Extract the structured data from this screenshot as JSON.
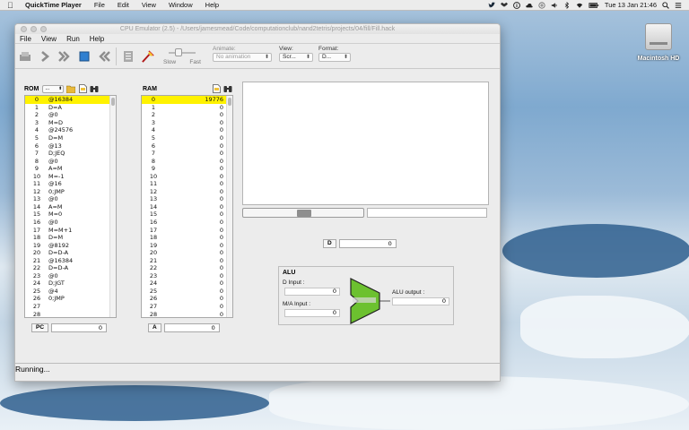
{
  "menubar": {
    "app_name": "QuickTime Player",
    "items": [
      "File",
      "Edit",
      "View",
      "Window",
      "Help"
    ],
    "clock": "Tue 13 Jan  21:46"
  },
  "desktop": {
    "drive_label": "Macintosh HD"
  },
  "window": {
    "title": "CPU Emulator (2.5) - /Users/jamesmead/Code/computationclub/nand2tetris/projects/04/fill/Fill.hack",
    "menu": [
      "File",
      "View",
      "Run",
      "Help"
    ]
  },
  "toolbar": {
    "slow_label": "Slow",
    "fast_label": "Fast",
    "animate_label": "Animate:",
    "animate_value": "No animation",
    "view_label": "View:",
    "view_value": "Scr...",
    "format_label": "Format:",
    "format_value": "D..."
  },
  "rom": {
    "label": "ROM",
    "format_value": "...",
    "rows": [
      {
        "i": "0",
        "v": "@16384"
      },
      {
        "i": "1",
        "v": "D=A"
      },
      {
        "i": "2",
        "v": "@0"
      },
      {
        "i": "3",
        "v": "M=D"
      },
      {
        "i": "4",
        "v": "@24576"
      },
      {
        "i": "5",
        "v": "D=M"
      },
      {
        "i": "6",
        "v": "@13"
      },
      {
        "i": "7",
        "v": "D;JEQ"
      },
      {
        "i": "8",
        "v": "@0"
      },
      {
        "i": "9",
        "v": "A=M"
      },
      {
        "i": "10",
        "v": "M=-1"
      },
      {
        "i": "11",
        "v": "@16"
      },
      {
        "i": "12",
        "v": "0;JMP"
      },
      {
        "i": "13",
        "v": "@0"
      },
      {
        "i": "14",
        "v": "A=M"
      },
      {
        "i": "15",
        "v": "M=0"
      },
      {
        "i": "16",
        "v": "@0"
      },
      {
        "i": "17",
        "v": "M=M+1"
      },
      {
        "i": "18",
        "v": "D=M"
      },
      {
        "i": "19",
        "v": "@8192"
      },
      {
        "i": "20",
        "v": "D=D-A"
      },
      {
        "i": "21",
        "v": "@16384"
      },
      {
        "i": "22",
        "v": "D=D-A"
      },
      {
        "i": "23",
        "v": "@0"
      },
      {
        "i": "24",
        "v": "D;JGT"
      },
      {
        "i": "25",
        "v": "@4"
      },
      {
        "i": "26",
        "v": "0;JMP"
      },
      {
        "i": "27",
        "v": ""
      },
      {
        "i": "28",
        "v": ""
      }
    ],
    "pc_label": "PC",
    "pc_value": "0"
  },
  "ram": {
    "label": "RAM",
    "rows": [
      {
        "i": "0",
        "v": "19776"
      },
      {
        "i": "1",
        "v": "0"
      },
      {
        "i": "2",
        "v": "0"
      },
      {
        "i": "3",
        "v": "0"
      },
      {
        "i": "4",
        "v": "0"
      },
      {
        "i": "5",
        "v": "0"
      },
      {
        "i": "6",
        "v": "0"
      },
      {
        "i": "7",
        "v": "0"
      },
      {
        "i": "8",
        "v": "0"
      },
      {
        "i": "9",
        "v": "0"
      },
      {
        "i": "10",
        "v": "0"
      },
      {
        "i": "11",
        "v": "0"
      },
      {
        "i": "12",
        "v": "0"
      },
      {
        "i": "13",
        "v": "0"
      },
      {
        "i": "14",
        "v": "0"
      },
      {
        "i": "15",
        "v": "0"
      },
      {
        "i": "16",
        "v": "0"
      },
      {
        "i": "17",
        "v": "0"
      },
      {
        "i": "18",
        "v": "0"
      },
      {
        "i": "19",
        "v": "0"
      },
      {
        "i": "20",
        "v": "0"
      },
      {
        "i": "21",
        "v": "0"
      },
      {
        "i": "22",
        "v": "0"
      },
      {
        "i": "23",
        "v": "0"
      },
      {
        "i": "24",
        "v": "0"
      },
      {
        "i": "25",
        "v": "0"
      },
      {
        "i": "26",
        "v": "0"
      },
      {
        "i": "27",
        "v": "0"
      },
      {
        "i": "28",
        "v": "0"
      }
    ],
    "a_label": "A",
    "a_value": "0"
  },
  "d_register": {
    "label": "D",
    "value": "0"
  },
  "alu": {
    "title": "ALU",
    "d_input_label": "D Input :",
    "d_input_value": "0",
    "ma_input_label": "M/A Input :",
    "ma_input_value": "0",
    "output_label": "ALU output :",
    "output_value": "0",
    "color": "#6cc12f"
  },
  "status": "Running..."
}
